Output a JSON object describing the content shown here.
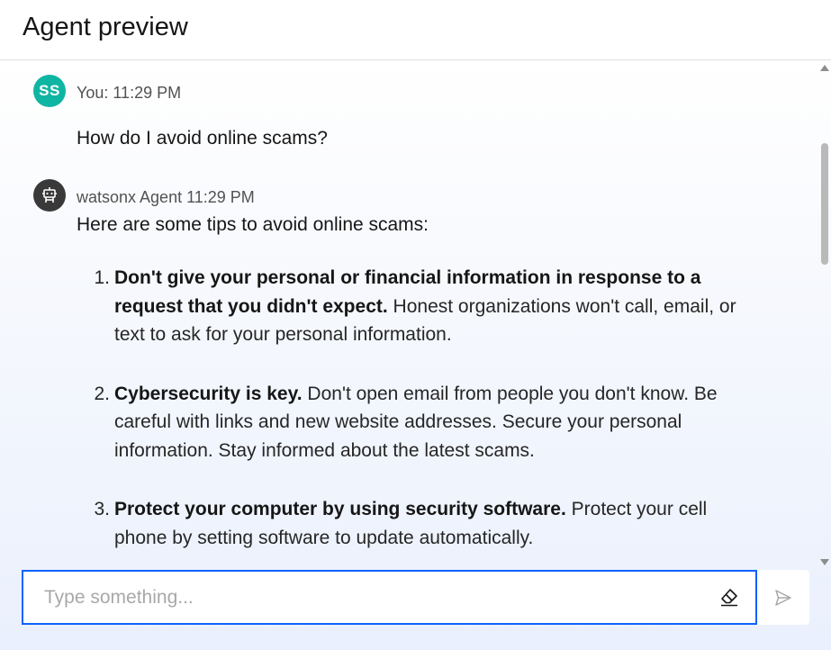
{
  "header": {
    "title": "Agent preview"
  },
  "messages": {
    "user": {
      "avatar_initials": "SS",
      "meta": "You: 11:29 PM",
      "text": "How do I avoid online scams?"
    },
    "agent": {
      "avatar_icon": "robot-icon",
      "meta": "watsonx Agent 11:29 PM",
      "intro": "Here are some tips to avoid online scams:",
      "tips": [
        {
          "num": "1.",
          "bold": "Don't give your personal or financial information in response to a request that you didn't expect.",
          "text": "Honest organizations won't call, email, or text to ask for your personal information."
        },
        {
          "num": "2.",
          "bold": "Cybersecurity is key.",
          "text": "Don't open email from people you don't know. Be careful with links and new website addresses. Secure your personal information. Stay informed about the latest scams."
        },
        {
          "num": "3.",
          "bold": "Protect your computer by using security software.",
          "text": "Protect your cell phone by setting software to update automatically."
        }
      ]
    }
  },
  "input": {
    "placeholder": "Type something...",
    "value": ""
  },
  "icons": {
    "clear": "eraser-icon",
    "send": "send-icon"
  },
  "colors": {
    "accent": "#0f62fe",
    "user_avatar": "#0fb5a3",
    "agent_avatar": "#393939"
  }
}
